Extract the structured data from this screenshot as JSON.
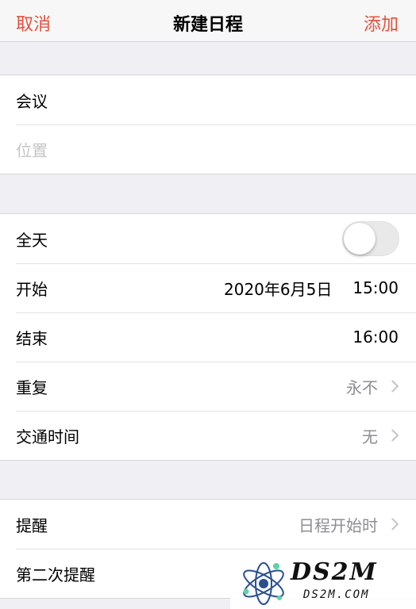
{
  "navbar": {
    "cancel_label": "取消",
    "title": "新建日程",
    "add_label": "添加"
  },
  "event": {
    "title_value": "会议",
    "location_placeholder": "位置"
  },
  "time": {
    "all_day_label": "全天",
    "all_day_on": false,
    "start_label": "开始",
    "start_date": "2020年6月5日",
    "start_time": "15:00",
    "end_label": "结束",
    "end_time": "16:00",
    "repeat_label": "重复",
    "repeat_value": "永不",
    "travel_label": "交通时间",
    "travel_value": "无"
  },
  "alerts": {
    "alert_label": "提醒",
    "alert_value": "日程开始时",
    "second_alert_label": "第二次提醒"
  },
  "watermark": {
    "logo_text": "DS2M",
    "domain_text": "DS2M.COM"
  },
  "colors": {
    "accent": "#e5503d",
    "background": "#efeff4",
    "muted": "#8e8e93"
  }
}
